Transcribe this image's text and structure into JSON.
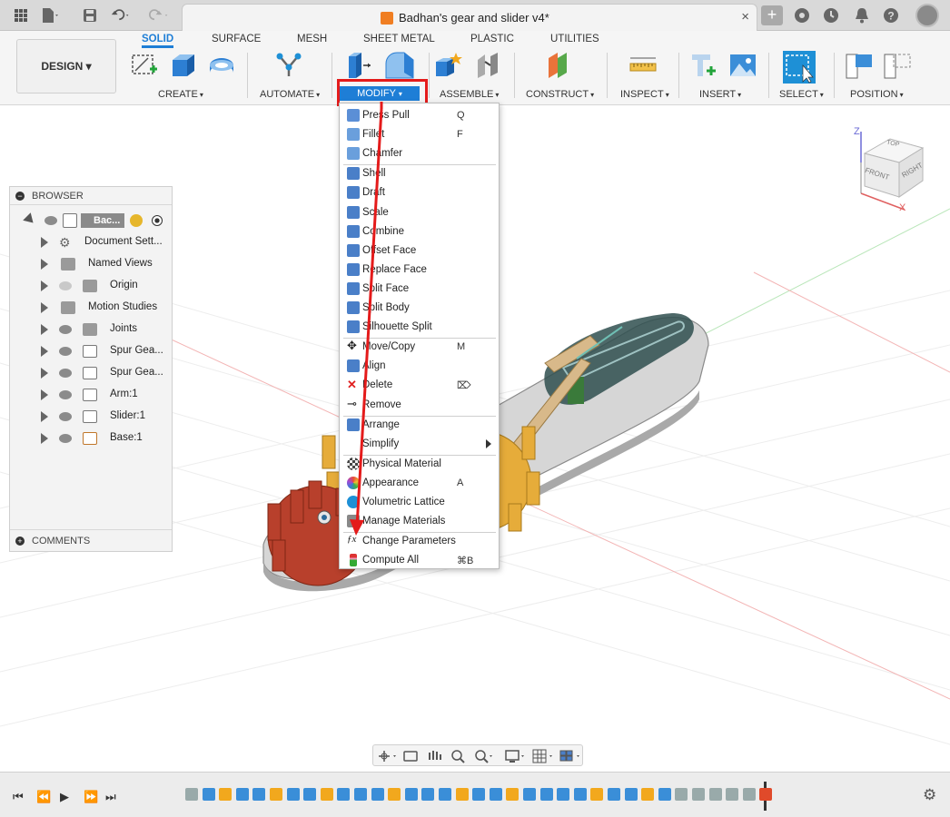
{
  "window": {
    "title": "Badhan's gear and slider v4*",
    "close_glyph": "×",
    "new_tab_glyph": "+"
  },
  "ribbon": {
    "workspace_button": "DESIGN ▾",
    "tabs": [
      {
        "label": "SOLID",
        "active": true
      },
      {
        "label": "SURFACE"
      },
      {
        "label": "MESH"
      },
      {
        "label": "SHEET METAL"
      },
      {
        "label": "PLASTIC"
      },
      {
        "label": "UTILITIES"
      }
    ],
    "groups": {
      "create": "CREATE",
      "automate": "AUTOMATE",
      "modify": "MODIFY",
      "assemble": "ASSEMBLE",
      "construct": "CONSTRUCT",
      "inspect": "INSPECT",
      "insert": "INSERT",
      "select": "SELECT",
      "position": "POSITION"
    },
    "caret": "▾",
    "accent_color": "#1e7ed6",
    "highlight_color": "#e41b1b"
  },
  "browser": {
    "header": "BROWSER",
    "footer": "COMMENTS",
    "root_label": "Bac...",
    "items": [
      {
        "label": "Document Sett...",
        "icon": "gear-icon"
      },
      {
        "label": "Named Views",
        "icon": "folder-icon"
      },
      {
        "label": "Origin",
        "icon": "folder-icon",
        "hidden": true
      },
      {
        "label": "Motion Studies",
        "icon": "folder-icon"
      },
      {
        "label": "Joints",
        "icon": "folder-icon"
      },
      {
        "label": "Spur Gea...",
        "icon": "component-icon"
      },
      {
        "label": "Spur Gea...",
        "icon": "component-icon"
      },
      {
        "label": "Arm:1",
        "icon": "component-icon"
      },
      {
        "label": "Slider:1",
        "icon": "component-icon"
      },
      {
        "label": "Base:1",
        "icon": "component-icon"
      }
    ]
  },
  "modify_menu": {
    "items": [
      {
        "label": "Press Pull",
        "shortcut": "Q",
        "icon": "press-pull-icon",
        "color": "#5b8fd6"
      },
      {
        "label": "Fillet",
        "shortcut": "F",
        "icon": "fillet-icon",
        "color": "#6a9fdc"
      },
      {
        "label": "Chamfer",
        "shortcut": "",
        "icon": "chamfer-icon",
        "color": "#6a9fdc"
      },
      {
        "label": "Shell",
        "shortcut": "",
        "icon": "shell-icon",
        "color": "#4a7fc8"
      },
      {
        "label": "Draft",
        "shortcut": "",
        "icon": "draft-icon",
        "color": "#4a7fc8"
      },
      {
        "label": "Scale",
        "shortcut": "",
        "icon": "scale-icon",
        "color": "#4a7fc8"
      },
      {
        "label": "Combine",
        "shortcut": "",
        "icon": "combine-icon",
        "color": "#4a7fc8"
      },
      {
        "label": "Offset Face",
        "shortcut": "",
        "icon": "offset-face-icon",
        "color": "#4a7fc8"
      },
      {
        "label": "Replace Face",
        "shortcut": "",
        "icon": "replace-face-icon",
        "color": "#4a7fc8"
      },
      {
        "label": "Split Face",
        "shortcut": "",
        "icon": "split-face-icon",
        "color": "#4a7fc8"
      },
      {
        "label": "Split Body",
        "shortcut": "",
        "icon": "split-body-icon",
        "color": "#4a7fc8"
      },
      {
        "label": "Silhouette Split",
        "shortcut": "",
        "icon": "silhouette-split-icon",
        "color": "#4a7fc8"
      },
      {
        "label": "Move/Copy",
        "shortcut": "M",
        "icon": "move-icon",
        "color": "#333333"
      },
      {
        "label": "Align",
        "shortcut": "",
        "icon": "align-icon",
        "color": "#4a7fc8"
      },
      {
        "label": "Delete",
        "shortcut": "⌦",
        "icon": "delete-icon",
        "color": "#e02020"
      },
      {
        "label": "Remove",
        "shortcut": "",
        "icon": "remove-icon",
        "color": "#333333"
      },
      {
        "label": "Arrange",
        "shortcut": "",
        "icon": "arrange-icon",
        "color": "#4a7fc8"
      },
      {
        "label": "Simplify",
        "shortcut": "",
        "icon": "simplify-icon",
        "color": "#ffffff",
        "submenu": true
      },
      {
        "label": "Physical Material",
        "shortcut": "",
        "icon": "physical-material-icon",
        "color": "#555555"
      },
      {
        "label": "Appearance",
        "shortcut": "A",
        "icon": "appearance-icon",
        "color": "#e8a030"
      },
      {
        "label": "Volumetric Lattice",
        "shortcut": "",
        "icon": "lattice-icon",
        "color": "#1e90d6"
      },
      {
        "label": "Manage Materials",
        "shortcut": "",
        "icon": "manage-materials-icon",
        "color": "#888888"
      },
      {
        "label": "Change Parameters",
        "shortcut": "",
        "icon": "fx-icon",
        "color": "#ffffff"
      },
      {
        "label": "Compute All",
        "shortcut": "⌘B",
        "icon": "compute-all-icon",
        "color": "#3a8a3a"
      }
    ]
  },
  "viewcube": {
    "top": "TOP",
    "front": "FRONT",
    "right": "RIGHT",
    "axis_z": "Z",
    "axis_x": "X"
  }
}
